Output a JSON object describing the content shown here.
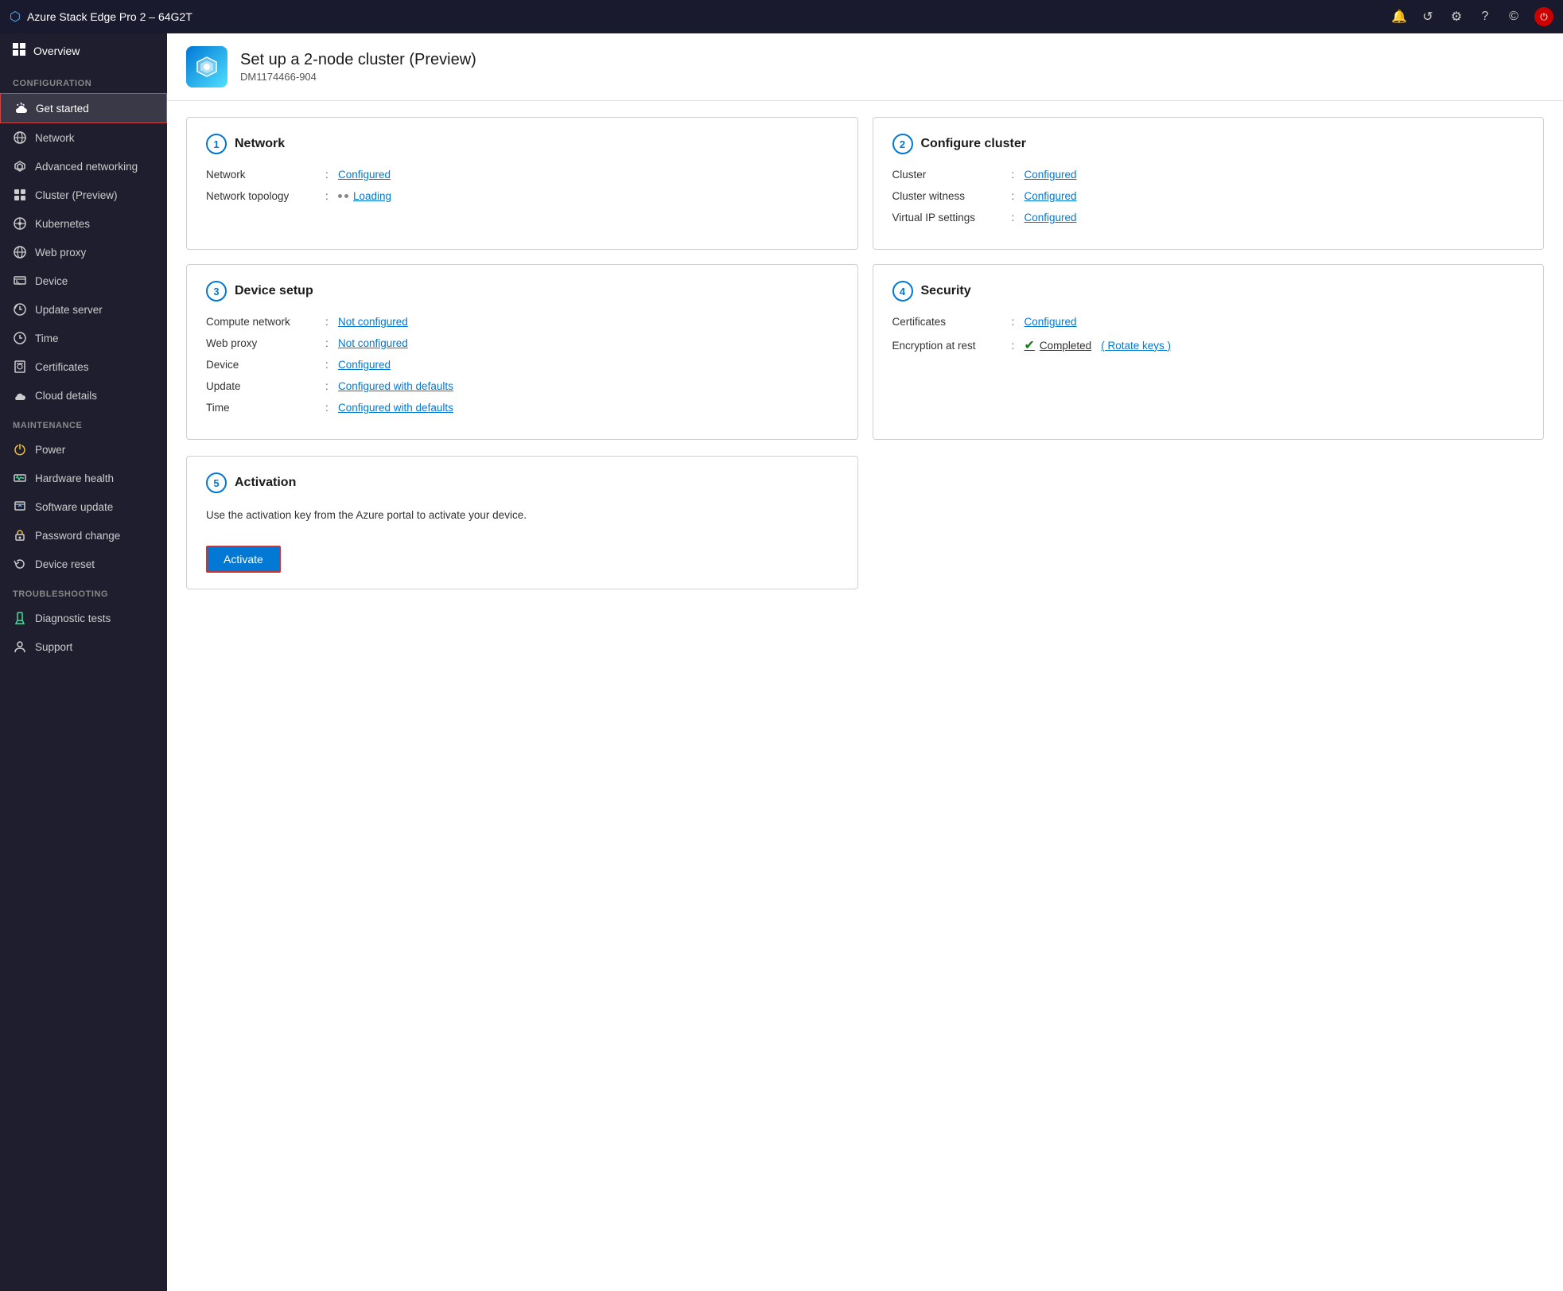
{
  "titleBar": {
    "title": "Azure Stack Edge Pro 2 – 64G2T",
    "icons": [
      "bell",
      "refresh",
      "gear",
      "help",
      "copyright",
      "power"
    ]
  },
  "sidebar": {
    "overview": {
      "label": "Overview"
    },
    "sections": [
      {
        "label": "CONFIGURATION",
        "items": [
          {
            "id": "get-started",
            "label": "Get started",
            "active": true,
            "icon": "cloud"
          },
          {
            "id": "network",
            "label": "Network",
            "active": false,
            "icon": "network"
          },
          {
            "id": "advanced-networking",
            "label": "Advanced networking",
            "active": false,
            "icon": "advanced-network"
          },
          {
            "id": "cluster-preview",
            "label": "Cluster (Preview)",
            "active": false,
            "icon": "cluster"
          },
          {
            "id": "kubernetes",
            "label": "Kubernetes",
            "active": false,
            "icon": "kubernetes"
          },
          {
            "id": "web-proxy",
            "label": "Web proxy",
            "active": false,
            "icon": "web-proxy"
          },
          {
            "id": "device",
            "label": "Device",
            "active": false,
            "icon": "device"
          },
          {
            "id": "update-server",
            "label": "Update server",
            "active": false,
            "icon": "update-server"
          },
          {
            "id": "time",
            "label": "Time",
            "active": false,
            "icon": "time"
          },
          {
            "id": "certificates",
            "label": "Certificates",
            "active": false,
            "icon": "certificates"
          },
          {
            "id": "cloud-details",
            "label": "Cloud details",
            "active": false,
            "icon": "cloud-details"
          }
        ]
      },
      {
        "label": "MAINTENANCE",
        "items": [
          {
            "id": "power",
            "label": "Power",
            "active": false,
            "icon": "power"
          },
          {
            "id": "hardware-health",
            "label": "Hardware health",
            "active": false,
            "icon": "hardware-health"
          },
          {
            "id": "software-update",
            "label": "Software update",
            "active": false,
            "icon": "software-update"
          },
          {
            "id": "password-change",
            "label": "Password change",
            "active": false,
            "icon": "password-change"
          },
          {
            "id": "device-reset",
            "label": "Device reset",
            "active": false,
            "icon": "device-reset"
          }
        ]
      },
      {
        "label": "TROUBLESHOOTING",
        "items": [
          {
            "id": "diagnostic-tests",
            "label": "Diagnostic tests",
            "active": false,
            "icon": "diagnostic-tests"
          },
          {
            "id": "support",
            "label": "Support",
            "active": false,
            "icon": "support"
          }
        ]
      }
    ]
  },
  "pageHeader": {
    "title": "Set up a 2-node cluster (Preview)",
    "subtitle": "DM1174466-904"
  },
  "cards": [
    {
      "id": "network",
      "number": "1",
      "title": "Network",
      "rows": [
        {
          "label": "Network",
          "value": "Configured",
          "type": "link"
        },
        {
          "label": "Network topology",
          "value": "Loading",
          "type": "loading"
        }
      ]
    },
    {
      "id": "configure-cluster",
      "number": "2",
      "title": "Configure cluster",
      "rows": [
        {
          "label": "Cluster",
          "value": "Configured",
          "type": "link"
        },
        {
          "label": "Cluster witness",
          "value": "Configured",
          "type": "link"
        },
        {
          "label": "Virtual IP settings",
          "value": "Configured",
          "type": "link"
        }
      ]
    },
    {
      "id": "device-setup",
      "number": "3",
      "title": "Device setup",
      "rows": [
        {
          "label": "Compute network",
          "value": "Not configured",
          "type": "link"
        },
        {
          "label": "Web proxy",
          "value": "Not configured",
          "type": "link"
        },
        {
          "label": "Device",
          "value": "Configured",
          "type": "link"
        },
        {
          "label": "Update",
          "value": "Configured with defaults",
          "type": "link"
        },
        {
          "label": "Time",
          "value": "Configured with defaults",
          "type": "link"
        }
      ]
    },
    {
      "id": "security",
      "number": "4",
      "title": "Security",
      "rows": [
        {
          "label": "Certificates",
          "value": "Configured",
          "type": "link"
        },
        {
          "label": "Encryption at rest",
          "value": "Completed",
          "type": "completed",
          "extra": "( Rotate keys )"
        }
      ]
    }
  ],
  "activation": {
    "number": "5",
    "title": "Activation",
    "description": "Use the activation key from the Azure portal to activate your device.",
    "buttonLabel": "Activate"
  }
}
